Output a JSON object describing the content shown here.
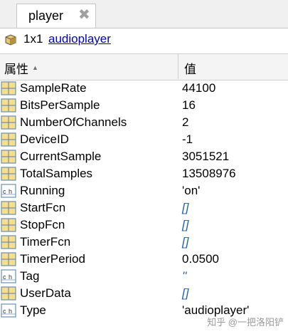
{
  "tab": {
    "label": "player",
    "close_glyph": "✖"
  },
  "object": {
    "size": "1x1",
    "class_name": "audioplayer",
    "icon": "object-icon"
  },
  "columns": {
    "property": "属性",
    "value": "值",
    "sort_glyph": "▲"
  },
  "properties": [
    {
      "name": "SampleRate",
      "value": "44100",
      "icon": "grid-icon",
      "empty": false
    },
    {
      "name": "BitsPerSample",
      "value": "16",
      "icon": "grid-icon",
      "empty": false
    },
    {
      "name": "NumberOfChannels",
      "value": "2",
      "icon": "grid-icon",
      "empty": false
    },
    {
      "name": "DeviceID",
      "value": "-1",
      "icon": "grid-icon",
      "empty": false
    },
    {
      "name": "CurrentSample",
      "value": "3051521",
      "icon": "grid-icon",
      "empty": false
    },
    {
      "name": "TotalSamples",
      "value": "13508976",
      "icon": "grid-icon",
      "empty": false
    },
    {
      "name": "Running",
      "value": "'on'",
      "icon": "char-icon",
      "empty": false
    },
    {
      "name": "StartFcn",
      "value": "[]",
      "icon": "grid-icon",
      "empty": true
    },
    {
      "name": "StopFcn",
      "value": "[]",
      "icon": "grid-icon",
      "empty": true
    },
    {
      "name": "TimerFcn",
      "value": "[]",
      "icon": "grid-icon",
      "empty": true
    },
    {
      "name": "TimerPeriod",
      "value": "0.0500",
      "icon": "grid-icon",
      "empty": false
    },
    {
      "name": "Tag",
      "value": "''",
      "icon": "char-icon",
      "empty": true
    },
    {
      "name": "UserData",
      "value": "[]",
      "icon": "grid-icon",
      "empty": true
    },
    {
      "name": "Type",
      "value": "'audioplayer'",
      "icon": "char-icon",
      "empty": false
    }
  ],
  "watermark": "知乎 @一把洛阳铲",
  "colors": {
    "grid_icon_fill": "#f7df8a",
    "grid_icon_border": "#6b8fb8",
    "empty_value": "#1f5fbf",
    "link": "#0000cc"
  }
}
